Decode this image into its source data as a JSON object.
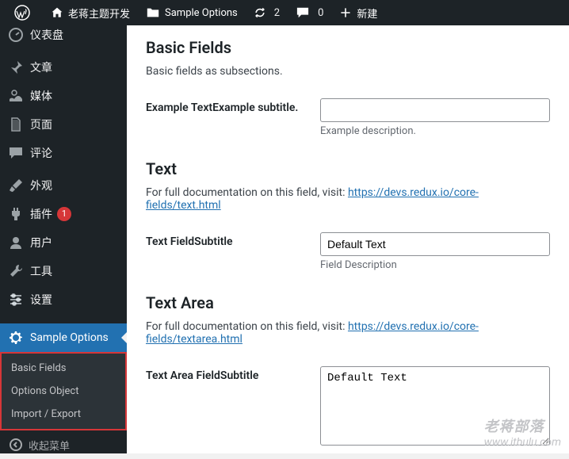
{
  "adminbar": {
    "site_title": "老蒋主题开发",
    "sample_options": "Sample Options",
    "refresh_count": "2",
    "comments_count": "0",
    "new_label": "新建"
  },
  "sidebar": {
    "items": [
      {
        "label": "仪表盘"
      },
      {
        "label": "文章"
      },
      {
        "label": "媒体"
      },
      {
        "label": "页面"
      },
      {
        "label": "评论"
      },
      {
        "label": "外观"
      },
      {
        "label": "插件",
        "badge": "1"
      },
      {
        "label": "用户"
      },
      {
        "label": "工具"
      },
      {
        "label": "设置"
      }
    ],
    "active": {
      "label": "Sample Options"
    },
    "submenu": [
      {
        "label": "Basic Fields"
      },
      {
        "label": "Options Object"
      },
      {
        "label": "Import / Export"
      }
    ],
    "collapse": "收起菜单"
  },
  "main": {
    "basic": {
      "heading": "Basic Fields",
      "desc": "Basic fields as subsections.",
      "example_label": "Example TextExample subtitle.",
      "example_help": "Example description."
    },
    "text": {
      "heading": "Text",
      "doc_prefix": "For full documentation on this field, visit: ",
      "doc_link": "https://devs.redux.io/core-fields/text.html",
      "field_label": "Text FieldSubtitle",
      "field_value": "Default Text",
      "field_help": "Field Description"
    },
    "textarea": {
      "heading": "Text Area",
      "doc_prefix": "For full documentation on this field, visit: ",
      "doc_link": "https://devs.redux.io/core-fields/textarea.html",
      "field_label": "Text Area FieldSubtitle",
      "field_value": "Default Text"
    }
  },
  "watermark": {
    "cn": "老蒋部落",
    "en": "www.itbulu.com"
  }
}
